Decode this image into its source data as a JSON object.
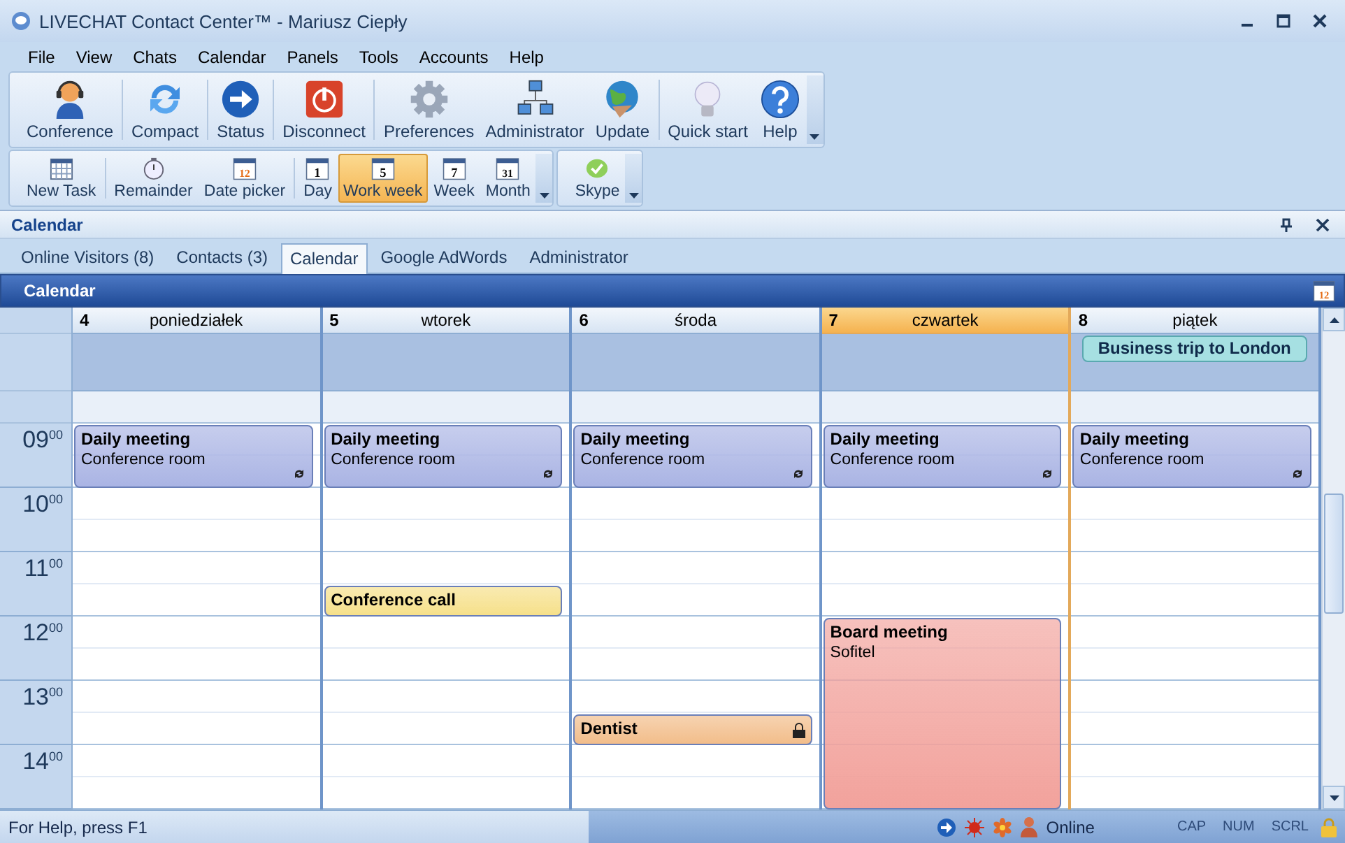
{
  "window": {
    "title": "LIVECHAT Contact Center™ - Mariusz Ciepły"
  },
  "menu": [
    "File",
    "View",
    "Chats",
    "Calendar",
    "Panels",
    "Tools",
    "Accounts",
    "Help"
  ],
  "toolbar_main": {
    "groups": [
      [
        {
          "label": "Conference"
        }
      ],
      [
        {
          "label": "Compact"
        }
      ],
      [
        {
          "label": "Status"
        }
      ],
      [
        {
          "label": "Disconnect"
        }
      ],
      [
        {
          "label": "Preferences"
        },
        {
          "label": "Administrator"
        },
        {
          "label": "Update"
        }
      ],
      [
        {
          "label": "Quick start"
        },
        {
          "label": "Help"
        }
      ]
    ]
  },
  "toolbar_views": {
    "groups": [
      [
        {
          "label": "New Task",
          "selected": false
        }
      ],
      [
        {
          "label": "Remainder",
          "selected": false
        },
        {
          "label": "Date picker",
          "icon_text": "12",
          "selected": false
        }
      ],
      [
        {
          "label": "Day",
          "icon_text": "1",
          "selected": false
        },
        {
          "label": "Work week",
          "icon_text": "5",
          "selected": true
        },
        {
          "label": "Week",
          "icon_text": "7",
          "selected": false
        },
        {
          "label": "Month",
          "icon_text": "31",
          "selected": false
        }
      ]
    ]
  },
  "toolbar_skype": {
    "label": "Skype"
  },
  "panel": {
    "title": "Calendar"
  },
  "tabs": [
    {
      "label": "Online Visitors (8)",
      "selected": false
    },
    {
      "label": "Contacts (3)",
      "selected": false
    },
    {
      "label": "Calendar",
      "selected": true
    },
    {
      "label": "Google AdWords",
      "selected": false
    },
    {
      "label": "Administrator",
      "selected": false
    }
  ],
  "calendar": {
    "title": "Calendar",
    "header_icon_text": "12",
    "hours": [
      "09$^{00}$",
      "10$^{00}$",
      "11$^{00}$",
      "12$^{00}$",
      "13$^{00}$",
      "14$^{00}$"
    ],
    "days": [
      {
        "number": "4",
        "name": "poniedziałek",
        "today": false,
        "events": [
          {
            "title": "Daily meeting",
            "location": "Conference room",
            "kind": "recurring",
            "color": "#aab4e4"
          }
        ]
      },
      {
        "number": "5",
        "name": "wtorek",
        "today": false,
        "events": [
          {
            "title": "Daily meeting",
            "location": "Conference room",
            "kind": "recurring",
            "color": "#aab4e4"
          },
          {
            "title": "Conference call",
            "kind": "plain",
            "color": "#f6e08a"
          }
        ]
      },
      {
        "number": "6",
        "name": "środa",
        "today": false,
        "events": [
          {
            "title": "Daily meeting",
            "location": "Conference room",
            "kind": "recurring",
            "color": "#aab4e4"
          },
          {
            "title": "Dentist",
            "kind": "private",
            "color": "#f2bd8a"
          }
        ]
      },
      {
        "number": "7",
        "name": "czwartek",
        "today": true,
        "events": [
          {
            "title": "Daily meeting",
            "location": "Conference room",
            "kind": "recurring",
            "color": "#aab4e4"
          },
          {
            "title": "Board meeting",
            "location": "Sofitel",
            "kind": "plain",
            "color": "#f2a29c"
          }
        ]
      },
      {
        "number": "8",
        "name": "piątek",
        "today": false,
        "all_day": [
          {
            "title": "Business trip to London",
            "color": "#a6e0e2"
          }
        ],
        "events": [
          {
            "title": "Daily meeting",
            "location": "Conference room",
            "kind": "recurring",
            "color": "#aab4e4"
          }
        ]
      }
    ]
  },
  "status_bar": {
    "help": "For Help, press F1",
    "presence": "Online",
    "indicators": [
      {
        "label": "CAP",
        "on": false
      },
      {
        "label": "NUM",
        "on": false
      },
      {
        "label": "SCRL",
        "on": false
      }
    ]
  }
}
